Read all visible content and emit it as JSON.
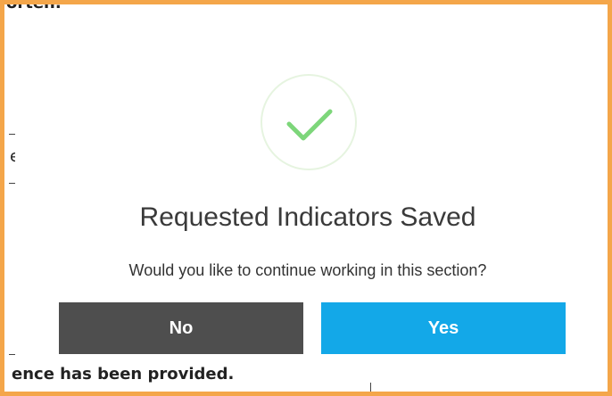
{
  "background": {
    "top_text": "orten.",
    "side_char": "e",
    "bottom_text": "ence has been provided."
  },
  "dialog": {
    "icon": "checkmark-icon",
    "title": "Requested Indicators Saved",
    "message": "Would you like to continue working in this section?",
    "no_label": "No",
    "yes_label": "Yes"
  },
  "colors": {
    "highlight_border": "#f4a64a",
    "check": "#7dd67a",
    "no_button": "#4e4e4e",
    "yes_button": "#13a8e8"
  }
}
